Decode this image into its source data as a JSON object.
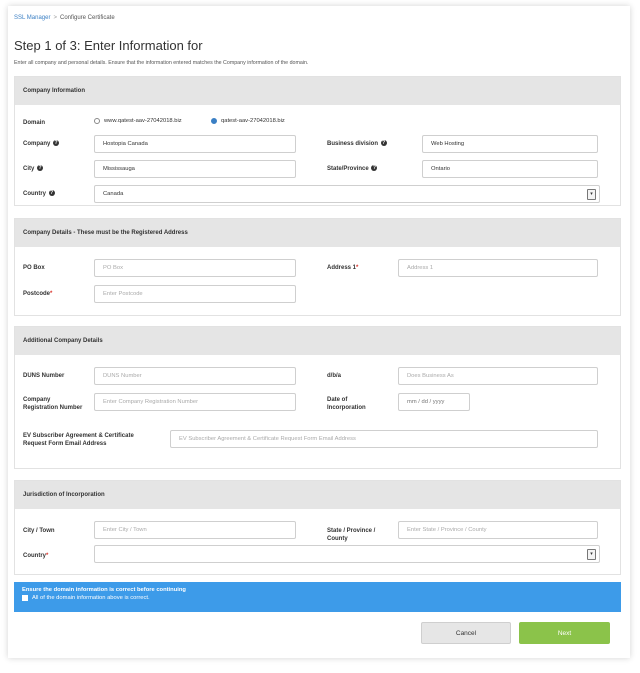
{
  "breadcrumb": {
    "root": "SSL Manager",
    "separator": ">",
    "current": "Configure Certificate"
  },
  "page_title": "Step 1 of 3: Enter Information for",
  "subtitle": "Enter all company and personal details. Ensure that the information entered matches the Company information of the domain.",
  "company_information": {
    "header": "Company Information",
    "domain_label": "Domain",
    "domain_options": [
      {
        "label": "www.qatest-aav-27042018.biz",
        "selected": false
      },
      {
        "label": "qatest-aav-27042018.biz",
        "selected": true
      }
    ],
    "company_label": "Company",
    "company_value": "Hostopia Canada",
    "business_division_label": "Business division",
    "business_division_value": "Web Hosting",
    "city_label": "City",
    "city_value": "Mississauga",
    "state_label": "State/Province",
    "state_value": "Ontario",
    "country_label": "Country",
    "country_value": "Canada"
  },
  "company_details": {
    "header": "Company Details - These must be the Registered Address",
    "po_box_label": "PO Box",
    "po_box_placeholder": "PO Box",
    "address1_label": "Address 1",
    "address1_placeholder": "Address 1",
    "postcode_label": "Postcode",
    "postcode_placeholder": "Enter Postcode"
  },
  "additional_details": {
    "header": "Additional Company Details",
    "duns_label": "DUNS Number",
    "duns_placeholder": "DUNS Number",
    "dba_label": "d/b/a",
    "dba_placeholder": "Does Business As",
    "reg_number_label": "Company Registration Number",
    "reg_number_placeholder": "Enter Company Registration Number",
    "incorporation_date_label": "Date of Incorporation",
    "incorporation_date_placeholder": "mm / dd / yyyy",
    "ev_email_label": "EV Subscriber Agreement & Certificate Request Form Email Address",
    "ev_email_placeholder": "EV Subscriber Agreement & Certificate Request Form Email Address"
  },
  "jurisdiction": {
    "header": "Jurisdiction of Incorporation",
    "city_label": "City / Town",
    "city_placeholder": "Enter City / Town",
    "state_label": "State / Province / County",
    "state_placeholder": "Enter State / Province / County",
    "country_label": "Country",
    "country_value": ""
  },
  "banner": {
    "title": "Ensure the domain information is correct before continuing",
    "checkbox_label": "All of the domain information above is correct."
  },
  "buttons": {
    "cancel": "Cancel",
    "next": "Next"
  },
  "colors": {
    "accent_blue": "#3d9be9",
    "link_blue": "#3a7fc4",
    "next_green": "#8bc34a",
    "required_red": "#d9342b"
  }
}
